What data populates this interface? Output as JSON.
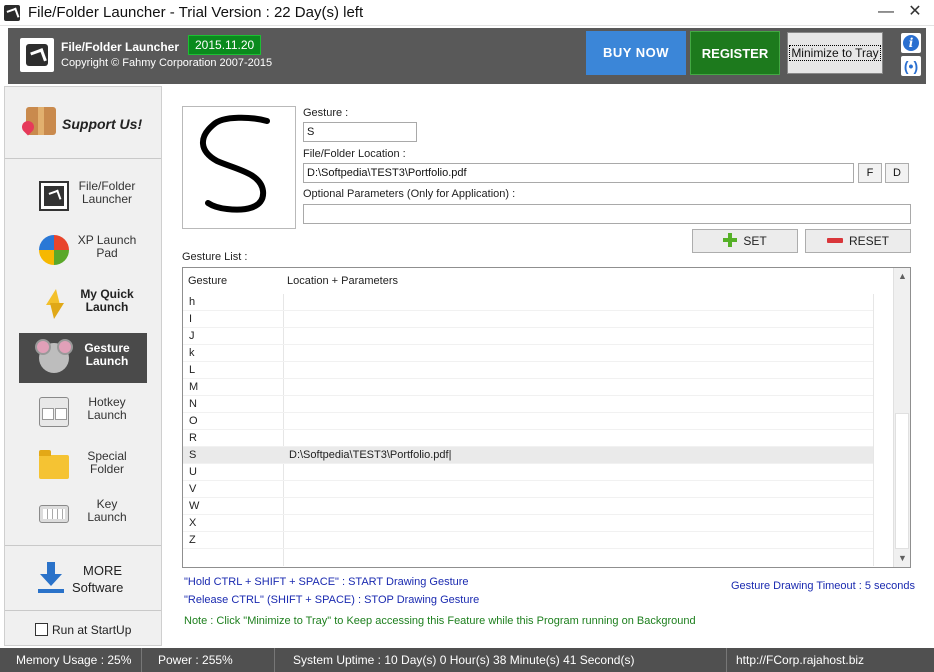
{
  "window": {
    "title": "File/Folder Launcher - Trial Version : 22 Day(s) left",
    "minimize_glyph": "—",
    "close_glyph": "✕"
  },
  "header": {
    "app_name": "File/Folder Launcher",
    "version": "2015.11.20",
    "copyright": "Copyright © Fahmy Corporation 2007-2015",
    "buy_now": "BUY NOW",
    "register": "REGISTER",
    "minimize_to_tray": "Minimize to Tray",
    "update_glyph": "(•)"
  },
  "sidebar": {
    "support": "Support Us!",
    "items": [
      {
        "line1": "File/Folder",
        "line2": "Launcher",
        "icon": "launcher-icon"
      },
      {
        "line1": "XP Launch",
        "line2": "Pad",
        "icon": "xp-logo-icon"
      },
      {
        "line1": "My Quick",
        "line2": "Launch",
        "icon": "lightning-icon"
      },
      {
        "line1": "Gesture",
        "line2": "Launch",
        "icon": "mouse-icon"
      },
      {
        "line1": "Hotkey",
        "line2": "Launch",
        "icon": "hotkey-icon"
      },
      {
        "line1": "Special",
        "line2": "Folder",
        "icon": "folder-icon"
      },
      {
        "line1": "Key",
        "line2": "Launch",
        "icon": "keyboard-icon"
      }
    ],
    "more_line1": "MORE",
    "more_line2": "Software",
    "run_at_startup": "Run at StartUp"
  },
  "form": {
    "gesture_label": "Gesture :",
    "gesture_value": "S",
    "location_label": "File/Folder Location :",
    "location_value": "D:\\Softpedia\\TEST3\\Portfolio.pdf",
    "file_button": "F",
    "dir_button": "D",
    "params_label": "Optional Parameters (Only for Application) :",
    "params_value": "",
    "set_button": "SET",
    "reset_button": "RESET",
    "drawn_gesture": "S"
  },
  "gesture_list": {
    "label": "Gesture List :",
    "col_gesture": "Gesture",
    "col_location": "Location + Parameters",
    "rows": [
      {
        "gesture": "h",
        "location": ""
      },
      {
        "gesture": "I",
        "location": ""
      },
      {
        "gesture": "J",
        "location": ""
      },
      {
        "gesture": "k",
        "location": ""
      },
      {
        "gesture": "L",
        "location": ""
      },
      {
        "gesture": "M",
        "location": ""
      },
      {
        "gesture": "N",
        "location": ""
      },
      {
        "gesture": "O",
        "location": ""
      },
      {
        "gesture": "R",
        "location": ""
      },
      {
        "gesture": "S",
        "location": "D:\\Softpedia\\TEST3\\Portfolio.pdf|"
      },
      {
        "gesture": "U",
        "location": ""
      },
      {
        "gesture": "V",
        "location": ""
      },
      {
        "gesture": "W",
        "location": ""
      },
      {
        "gesture": "X",
        "location": ""
      },
      {
        "gesture": "Z",
        "location": ""
      }
    ],
    "selected_index": 9
  },
  "hints": {
    "hold": "\"Hold CTRL + SHIFT + SPACE\" : START Drawing Gesture",
    "release": "\"Release CTRL\" (SHIFT + SPACE) : STOP Drawing Gesture",
    "timeout": "Gesture Drawing Timeout : 5 seconds",
    "note": "Note : Click \"Minimize to Tray\" to Keep accessing this Feature while this Program running on Background"
  },
  "status": {
    "memory": "Memory Usage : 25%",
    "power": "Power : 255%",
    "uptime": "System Uptime : 10 Day(s) 0 Hour(s) 38 Minute(s) 41 Second(s)",
    "url": "http://FCorp.rajahost.biz"
  },
  "colors": {
    "header_bg": "#595959",
    "buy_now": "#3b86d8",
    "register": "#1d7a1d",
    "version_badge": "#0a8a1d",
    "active_nav": "#4a4a4a",
    "hint_text": "#1a2ab0",
    "note_text": "#1d7f1d"
  }
}
